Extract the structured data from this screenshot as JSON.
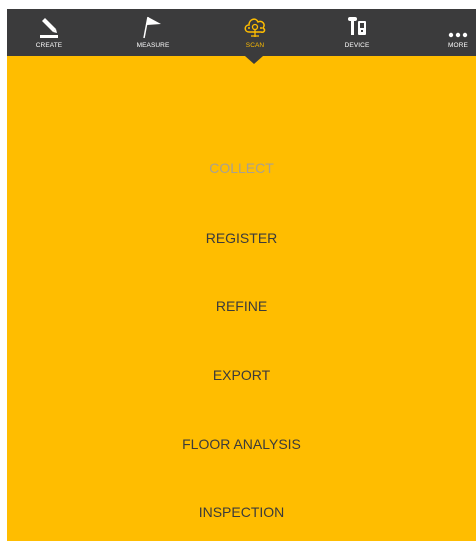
{
  "toolbar": {
    "tabs": [
      {
        "label": "CREATE",
        "icon": "pencil-icon"
      },
      {
        "label": "MEASURE",
        "icon": "flag-icon"
      },
      {
        "label": "SCAN",
        "icon": "cloud-scan-icon",
        "active": true
      },
      {
        "label": "DEVICE",
        "icon": "device-icon"
      },
      {
        "label": "MORE",
        "icon": "more-icon"
      }
    ]
  },
  "menu": {
    "items": [
      {
        "label": "COLLECT",
        "enabled": false
      },
      {
        "label": "REGISTER",
        "enabled": true
      },
      {
        "label": "REFINE",
        "enabled": true
      },
      {
        "label": "EXPORT",
        "enabled": true
      },
      {
        "label": "FLOOR ANALYSIS",
        "enabled": true
      },
      {
        "label": "INSPECTION",
        "enabled": true
      }
    ]
  },
  "colors": {
    "background": "#ffbd00",
    "toolbar": "#3b3b3c",
    "active_tab": "#ffbd00",
    "menu_text": "#3b3b3b",
    "disabled_text": "#a9a190"
  }
}
